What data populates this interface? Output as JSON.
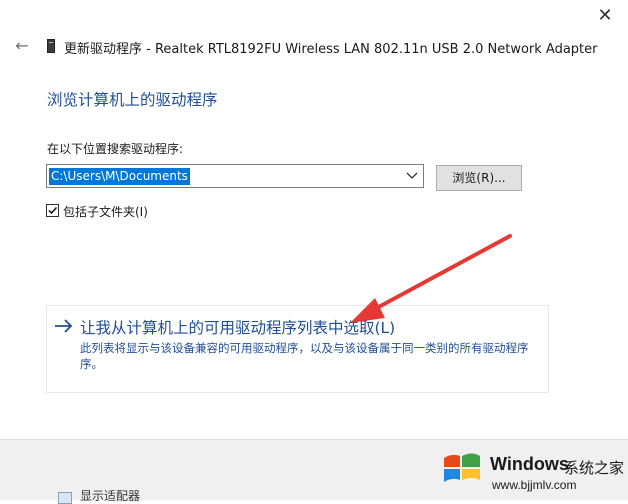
{
  "window": {
    "close_glyph": "✕",
    "back_glyph": "←",
    "title": "更新驱动程序 - Realtek RTL8192FU Wireless LAN 802.11n USB 2.0 Network Adapter"
  },
  "page": {
    "heading": "浏览计算机上的驱动程序"
  },
  "search": {
    "label": "在以下位置搜索驱动程序:",
    "path_value": "C:\\Users\\M\\Documents",
    "browse_label": "浏览(R)..."
  },
  "include_subfolders": {
    "checked": true,
    "label": "包括子文件夹(I)"
  },
  "pick_option": {
    "arrow_glyph": "→",
    "title": "让我从计算机上的可用驱动程序列表中选取(L)",
    "description": "此列表将显示与该设备兼容的可用驱动程序，以及与该设备属于同一类别的所有驱动程序序。"
  },
  "background": {
    "partial_item_label": "显示适配器"
  },
  "watermark": {
    "brand": "Windows",
    "site_name": "系统之家",
    "url": "www.bjjmlv.com"
  },
  "colors": {
    "accent": "#1f4e96",
    "selection": "#0078d7",
    "annotation_arrow": "#e53935"
  },
  "icons": [
    "close-icon",
    "back-arrow-icon",
    "device-icon",
    "dropdown-chevron-icon",
    "checkmark-icon",
    "right-arrow-icon",
    "windows-logo-icon"
  ]
}
